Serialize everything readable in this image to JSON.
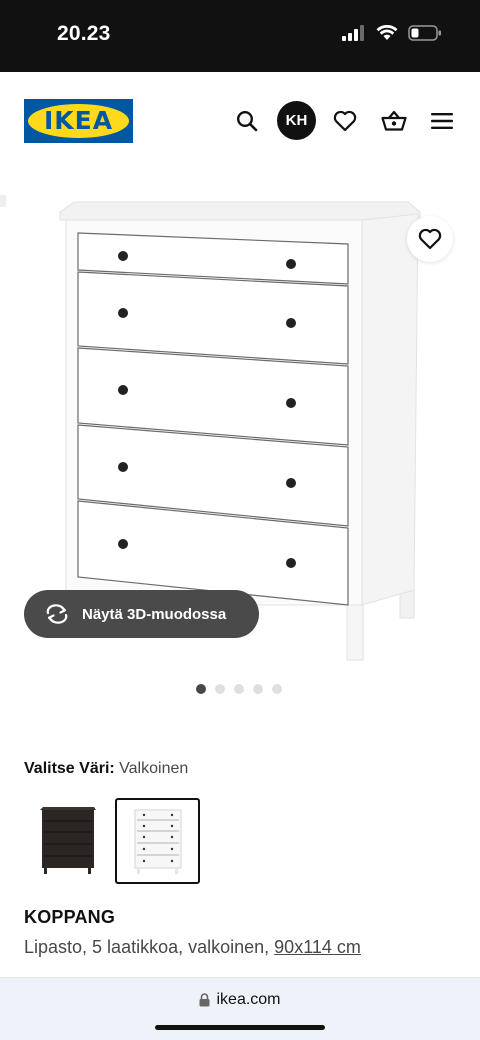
{
  "status_bar": {
    "time": "20.23",
    "signal_icon": "signal-icon",
    "wifi_icon": "wifi-icon",
    "battery_icon": "battery-icon"
  },
  "header": {
    "logo_text": "IKEA",
    "search_icon": "search-icon",
    "avatar_initials": "KH",
    "favorites_icon": "heart-icon",
    "cart_icon": "basket-icon",
    "menu_icon": "hamburger-menu-icon"
  },
  "gallery": {
    "favorite_icon": "heart-icon",
    "view_3d_label": "Näytä 3D-muodossa",
    "view_3d_icon": "rotate-3d-icon",
    "image_count": 5,
    "active_index": 0
  },
  "color": {
    "label": "Valitse Väri:",
    "value": "Valkoinen",
    "options": [
      {
        "name": "black-brown-dresser",
        "color": "#2b2624",
        "selected": false
      },
      {
        "name": "white-dresser",
        "color": "#f4f4f4",
        "selected": true
      }
    ]
  },
  "product": {
    "name": "KOPPANG",
    "description": "Lipasto, 5 laatikkoa, valkoinen,",
    "size": "90x114 cm"
  },
  "browser": {
    "url": "ikea.com",
    "lock_icon": "lock-icon"
  },
  "colors": {
    "ikea_blue": "#0058a3",
    "ikea_yellow": "#ffda1a",
    "button_dark": "#4a4a4a"
  }
}
